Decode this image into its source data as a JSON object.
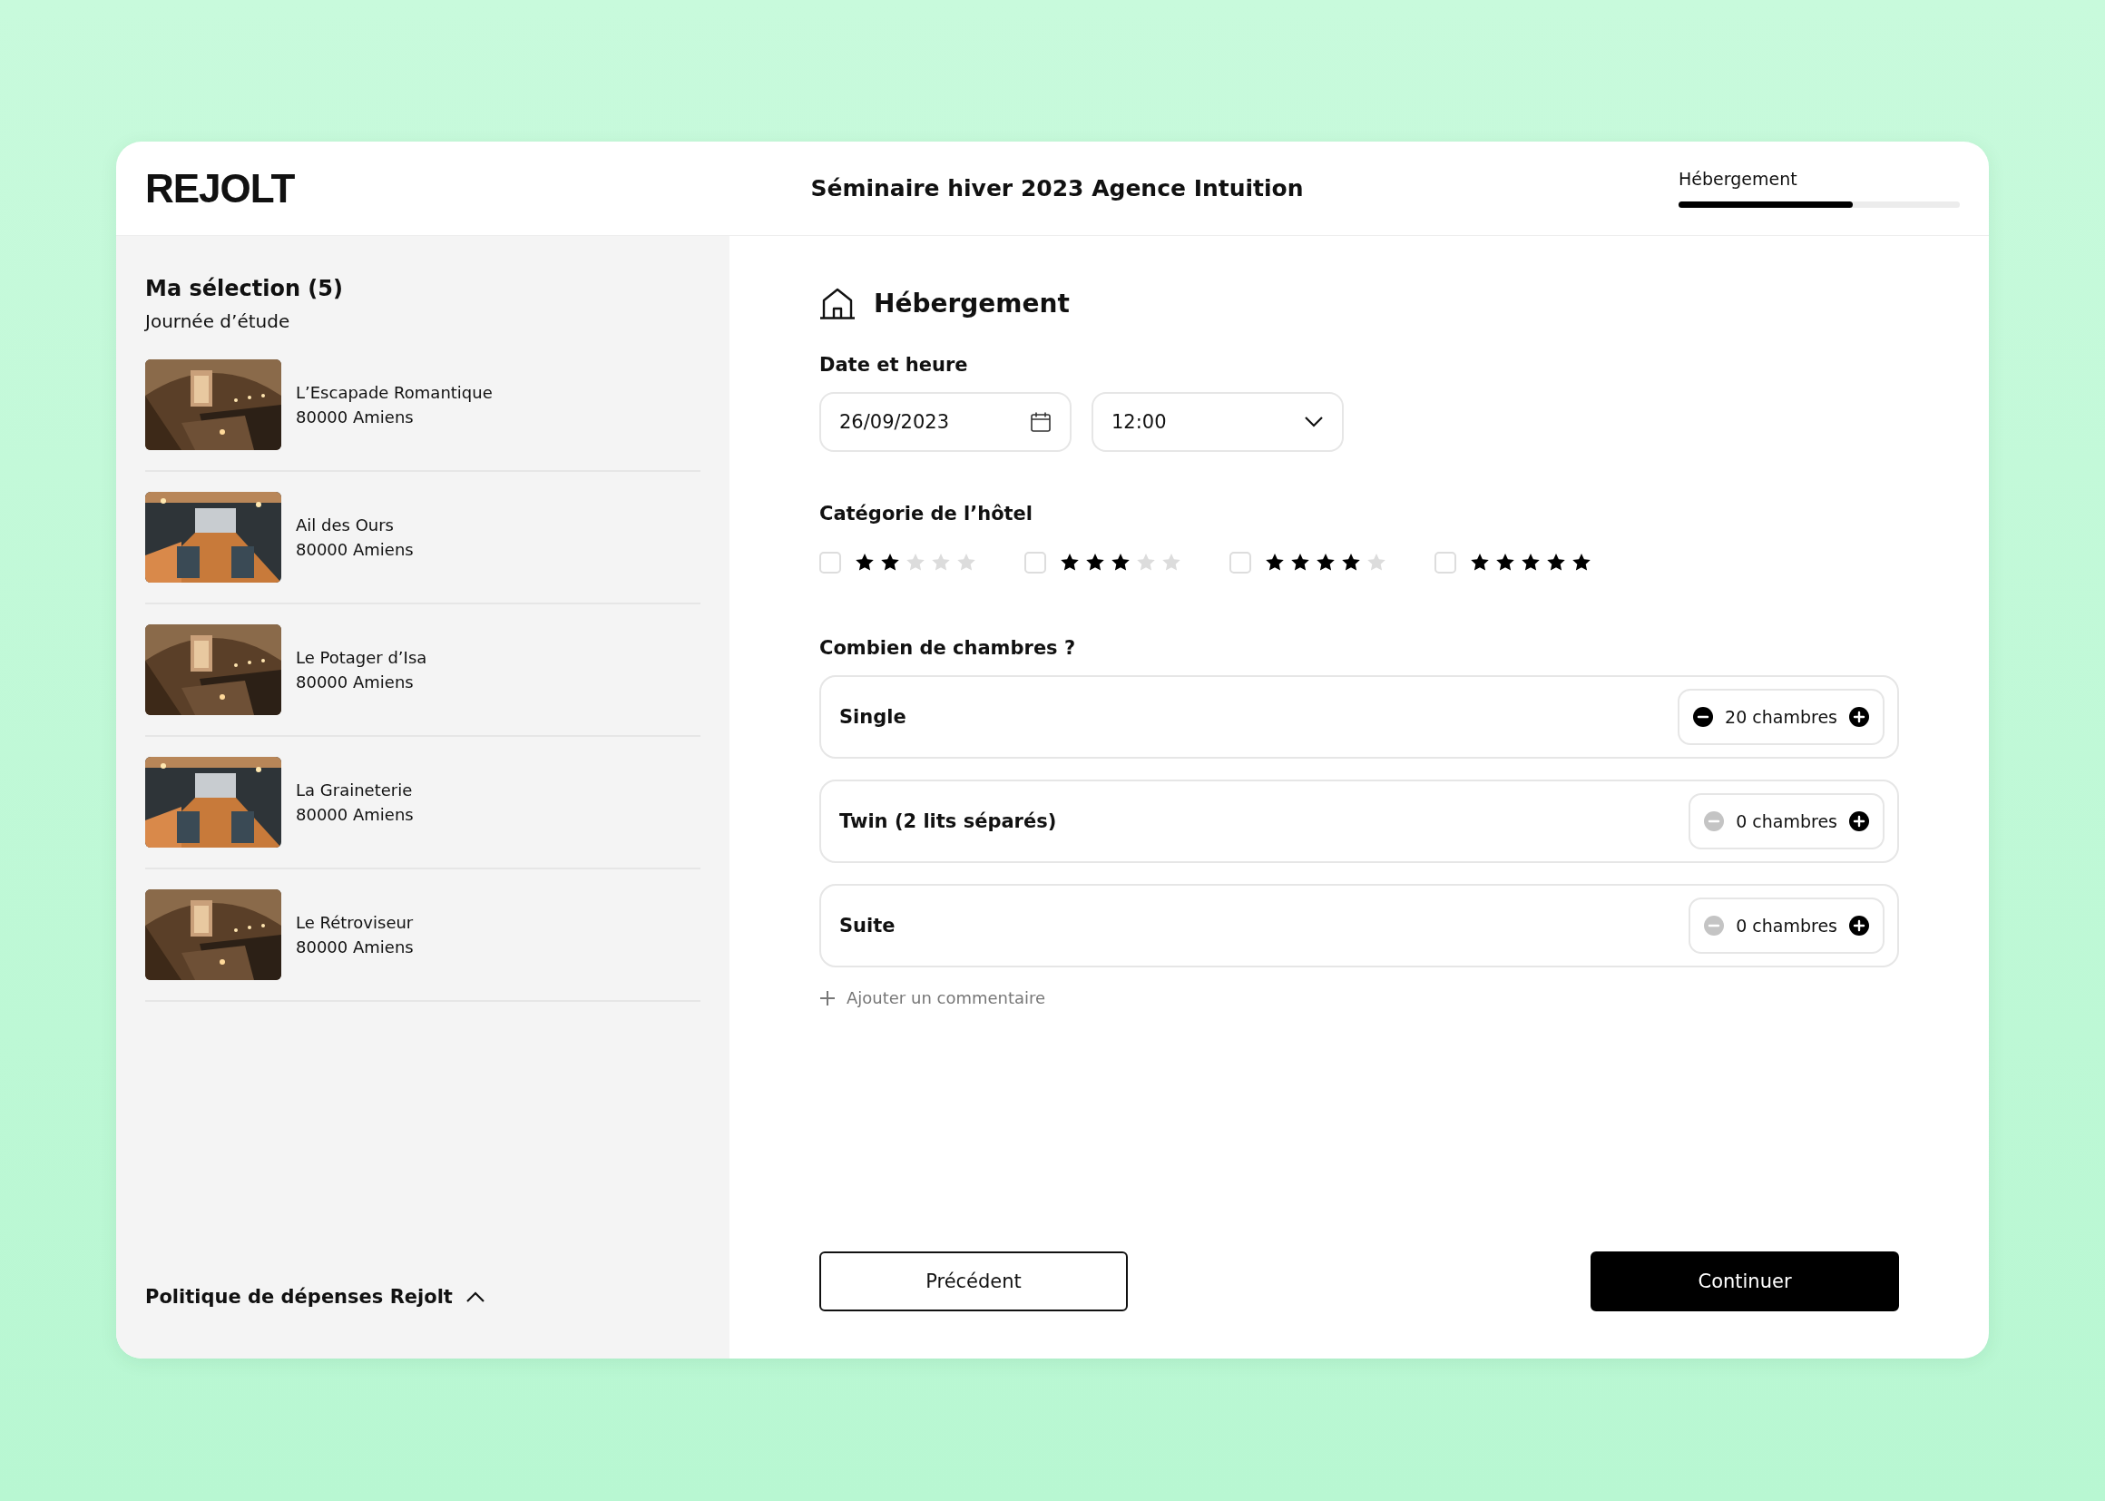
{
  "header": {
    "logo": "REJOLT",
    "title": "Séminaire hiver 2023 Agence Intuition",
    "progress": {
      "label": "Hébergement",
      "level": 0.62
    }
  },
  "sidebar": {
    "title": "Ma sélection (5)",
    "subtitle": "Journée d’étude",
    "items": [
      {
        "name": "L’Escapade Romantique",
        "city": "80000 Amiens"
      },
      {
        "name": "Ail des Ours",
        "city": "80000 Amiens"
      },
      {
        "name": "Le Potager d’Isa",
        "city": "80000 Amiens"
      },
      {
        "name": "La Graineterie",
        "city": "80000 Amiens"
      },
      {
        "name": "Le Rétroviseur",
        "city": "80000 Amiens"
      }
    ],
    "policy": {
      "label": "Politique de dépenses Rejolt",
      "expanded": true
    }
  },
  "form": {
    "heading": "Hébergement",
    "date_label": "Date et heure",
    "date": "26/09/2023",
    "time": "12:00",
    "category_label": "Catégorie de l’hôtel",
    "categories": [
      {
        "checked": false,
        "stars": 2
      },
      {
        "checked": false,
        "stars": 3
      },
      {
        "checked": false,
        "stars": 4
      },
      {
        "checked": false,
        "stars": 5
      }
    ],
    "rooms_label": "Combien de chambres ?",
    "rooms": [
      {
        "name": "Single",
        "count": "20 chambres",
        "minus_disabled": false
      },
      {
        "name": "Twin (2 lits séparés)",
        "count": "0 chambres",
        "minus_disabled": true
      },
      {
        "name": "Suite",
        "count": "0 chambres",
        "minus_disabled": true
      }
    ],
    "comment_link": "Ajouter un commentaire",
    "buttons": [
      {
        "label": "Précédent",
        "kind": "secondary"
      },
      {
        "label": "Continuer",
        "kind": "primary"
      }
    ]
  }
}
